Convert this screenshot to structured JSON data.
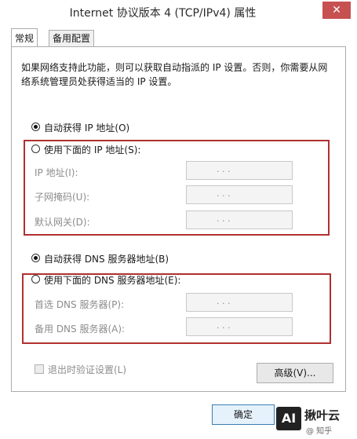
{
  "window": {
    "title": "Internet 协议版本 4 (TCP/IPv4) 属性",
    "close_glyph": "✕"
  },
  "tabs": [
    {
      "label": "常规",
      "active": true
    },
    {
      "label": "备用配置",
      "active": false
    }
  ],
  "description": "如果网络支持此功能，则可以获取自动指派的 IP 设置。否则，你需要从网络系统管理员处获得适当的 IP 设置。",
  "ip": {
    "auto_label": "自动获得 IP 地址(O)",
    "manual_label": "使用下面的 IP 地址(S):",
    "fields": [
      {
        "label": "IP 地址(I):",
        "value": ". . ."
      },
      {
        "label": "子网掩码(U):",
        "value": ". . ."
      },
      {
        "label": "默认网关(D):",
        "value": ". . ."
      }
    ]
  },
  "dns": {
    "auto_label": "自动获得 DNS 服务器地址(B)",
    "manual_label": "使用下面的 DNS 服务器地址(E):",
    "fields": [
      {
        "label": "首选 DNS 服务器(P):",
        "value": ". . ."
      },
      {
        "label": "备用 DNS 服务器(A):",
        "value": ". . ."
      }
    ]
  },
  "validate_label": "退出时验证设置(L)",
  "advanced_label": "高级(V)...",
  "ok_label": "确定",
  "watermark": {
    "logo": "AI",
    "text": "揪叶云",
    "sub": "@ 知乎"
  },
  "colors": {
    "highlight_box": "#b03030",
    "close_button": "#c75050"
  }
}
